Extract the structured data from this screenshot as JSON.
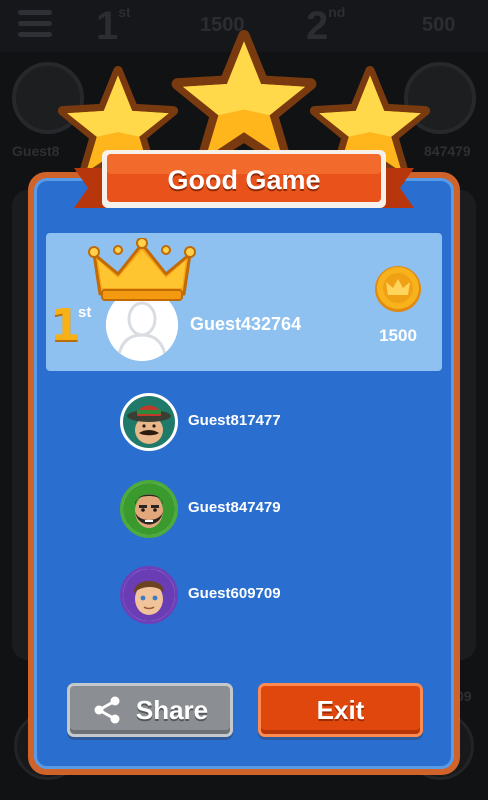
{
  "background": {
    "rank_first": "1",
    "rank_first_suffix": "st",
    "score_first": "1500",
    "rank_second": "2",
    "rank_second_suffix": "nd",
    "score_second": "500",
    "left_player_name": "Guest8",
    "right_player_name": "847479",
    "bottom_right_fragment": "09"
  },
  "dialog": {
    "title": "Good Game",
    "winner": {
      "rank": "1",
      "rank_suffix": "st",
      "name": "Guest432764",
      "coins": "1500"
    },
    "players": [
      {
        "name": "Guest817477",
        "avatar": "sombrero-mustache-avatar"
      },
      {
        "name": "Guest847479",
        "avatar": "bearded-man-avatar"
      },
      {
        "name": "Guest609709",
        "avatar": "young-man-avatar"
      }
    ],
    "buttons": {
      "share_label": "Share",
      "exit_label": "Exit"
    }
  },
  "colors": {
    "panel_blue": "#2a6fcf",
    "panel_border": "#d0632a",
    "winner_card": "#8ec1f0",
    "star_gold": "#ffc928",
    "ribbon_red": "#e9521a",
    "exit_orange": "#e0470d",
    "share_gray": "#8b8f93"
  }
}
